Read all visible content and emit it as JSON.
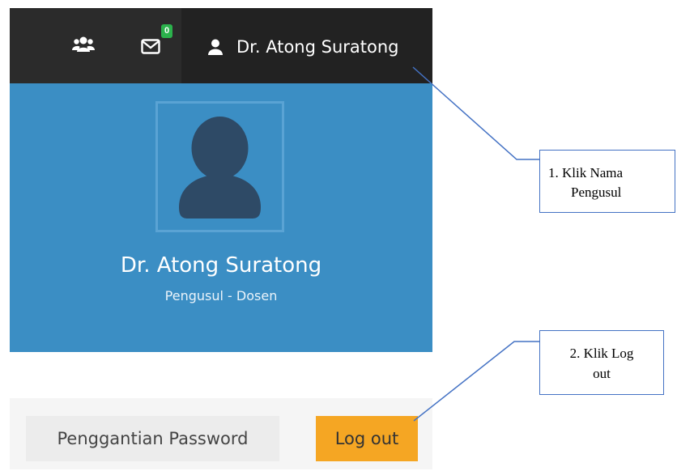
{
  "topbar": {
    "user_name": "Dr. Atong Suratong",
    "message_count": "0",
    "icons": [
      "users-icon",
      "envelope-icon",
      "user-icon"
    ]
  },
  "profile": {
    "name": "Dr. Atong Suratong",
    "role": "Pengusul - Dosen"
  },
  "footer": {
    "password_label": "Penggantian Password",
    "logout_label": "Log out"
  },
  "annotations": {
    "step1_line1": "1. Klik Nama",
    "step1_line2": "Pengusul",
    "step2_line1": "2. Klik Log",
    "step2_line2": "out"
  },
  "colors": {
    "topbar": "#2b2b2b",
    "panel": "#3b8ec4",
    "logout": "#f5a623",
    "badge": "#2bb24c",
    "callout_border": "#4472c4"
  }
}
